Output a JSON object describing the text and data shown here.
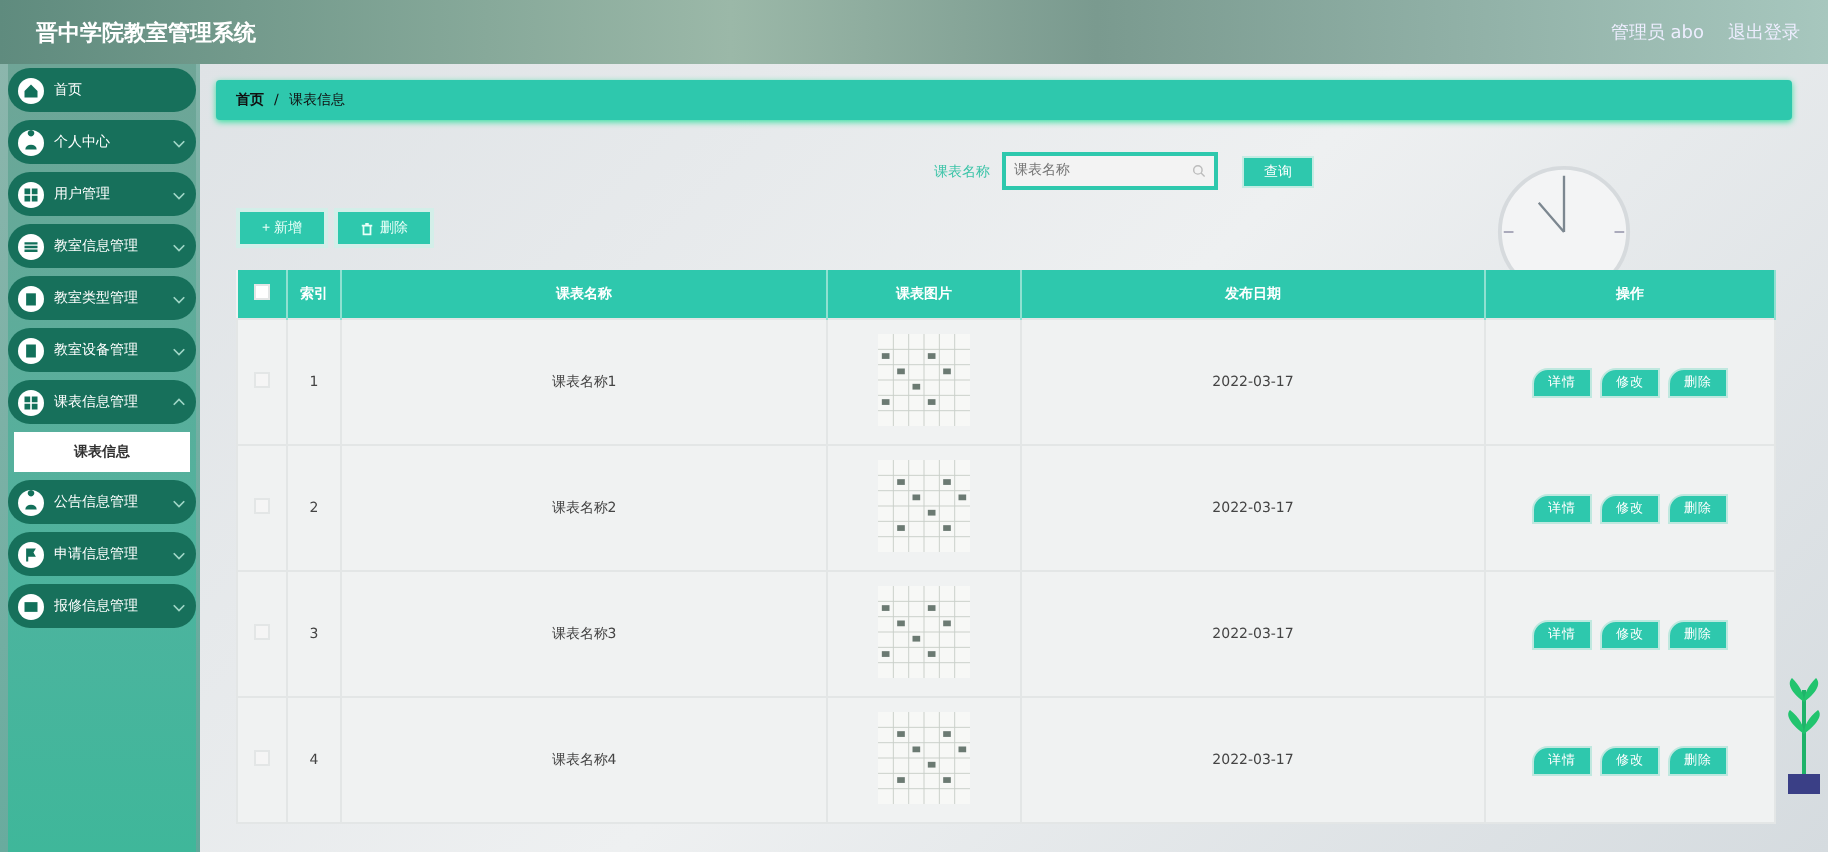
{
  "header": {
    "title": "晋中学院教室管理系统",
    "user": "管理员 abo",
    "logout": "退出登录"
  },
  "sidebar": {
    "items": [
      {
        "label": "首页",
        "has_children": false
      },
      {
        "label": "个人中心",
        "has_children": true,
        "expanded": false
      },
      {
        "label": "用户管理",
        "has_children": true,
        "expanded": false
      },
      {
        "label": "教室信息管理",
        "has_children": true,
        "expanded": false
      },
      {
        "label": "教室类型管理",
        "has_children": true,
        "expanded": false
      },
      {
        "label": "教室设备管理",
        "has_children": true,
        "expanded": false
      },
      {
        "label": "课表信息管理",
        "has_children": true,
        "expanded": true,
        "children": [
          {
            "label": "课表信息",
            "selected": true
          }
        ]
      },
      {
        "label": "公告信息管理",
        "has_children": true,
        "expanded": false
      },
      {
        "label": "申请信息管理",
        "has_children": true,
        "expanded": false
      },
      {
        "label": "报修信息管理",
        "has_children": true,
        "expanded": false
      }
    ]
  },
  "breadcrumb": [
    "首页",
    "/",
    "课表信息"
  ],
  "search": {
    "label": "课表名称",
    "placeholder": "课表名称",
    "button": "查询"
  },
  "toolbar": [
    {
      "label": "+ 新增",
      "kind": "add"
    },
    {
      "label": "删除",
      "kind": "delete"
    }
  ],
  "table": {
    "header_checked": false,
    "columns": [
      "索引",
      "课表名称",
      "课表图片",
      "发布日期",
      "操作"
    ],
    "rows": [
      {
        "checked": false,
        "index": "1",
        "name": "课表名称1",
        "date": "2022-03-17",
        "actions": [
          "详情",
          "修改",
          "删除"
        ]
      },
      {
        "checked": false,
        "index": "2",
        "name": "课表名称2",
        "date": "2022-03-17",
        "actions": [
          "详情",
          "修改",
          "删除"
        ]
      },
      {
        "checked": false,
        "index": "3",
        "name": "课表名称3",
        "date": "2022-03-17",
        "actions": [
          "详情",
          "修改",
          "删除"
        ]
      },
      {
        "checked": false,
        "index": "4",
        "name": "课表名称4",
        "date": "2022-03-17",
        "actions": [
          "详情",
          "修改",
          "删除"
        ]
      }
    ]
  }
}
